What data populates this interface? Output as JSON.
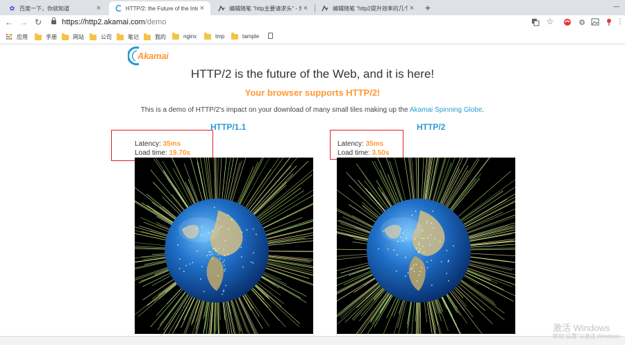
{
  "browser": {
    "tabs": [
      {
        "title": "百度一下，你就知道",
        "active": false
      },
      {
        "title": "HTTP/2: the Future of the Inte",
        "active": true
      },
      {
        "title": "编辑随笔 \"http主要请求头\" - 博",
        "active": false
      },
      {
        "title": "编辑随笔 \"http2提升效率的几个",
        "active": false
      }
    ],
    "new_tab_label": "+",
    "address": {
      "host": "https://http2.akamai.com",
      "path": "/demo"
    }
  },
  "bookmarks": [
    "应用",
    "手册",
    "网站",
    "公司",
    "笔记",
    "我的",
    "nginx",
    "tmp",
    "tample"
  ],
  "page": {
    "logo_text": "Akamai",
    "headline": "HTTP/2 is the future of the Web, and it is here!",
    "support_text": "Your browser supports HTTP/2!",
    "description_prefix": "This is a demo of HTTP/2's impact on your download of many small tiles making up the ",
    "description_link": "Akamai Spinning Globe",
    "description_suffix": ".",
    "columns": [
      {
        "title": "HTTP/1.1",
        "latency_label": "Latency:",
        "latency_value": "35ms",
        "load_label": "Load time:",
        "load_value": "19.70s"
      },
      {
        "title": "HTTP/2",
        "latency_label": "Latency:",
        "latency_value": "35ms",
        "load_label": "Load time:",
        "load_value": "3.50s"
      }
    ]
  },
  "watermark": {
    "line1": "激活 Windows",
    "line2": "转到\"设置\"以激活 Windows"
  },
  "colors": {
    "accent_orange": "#ff9933",
    "link_blue": "#2a9bd2",
    "highlight_red": "#e02020"
  }
}
